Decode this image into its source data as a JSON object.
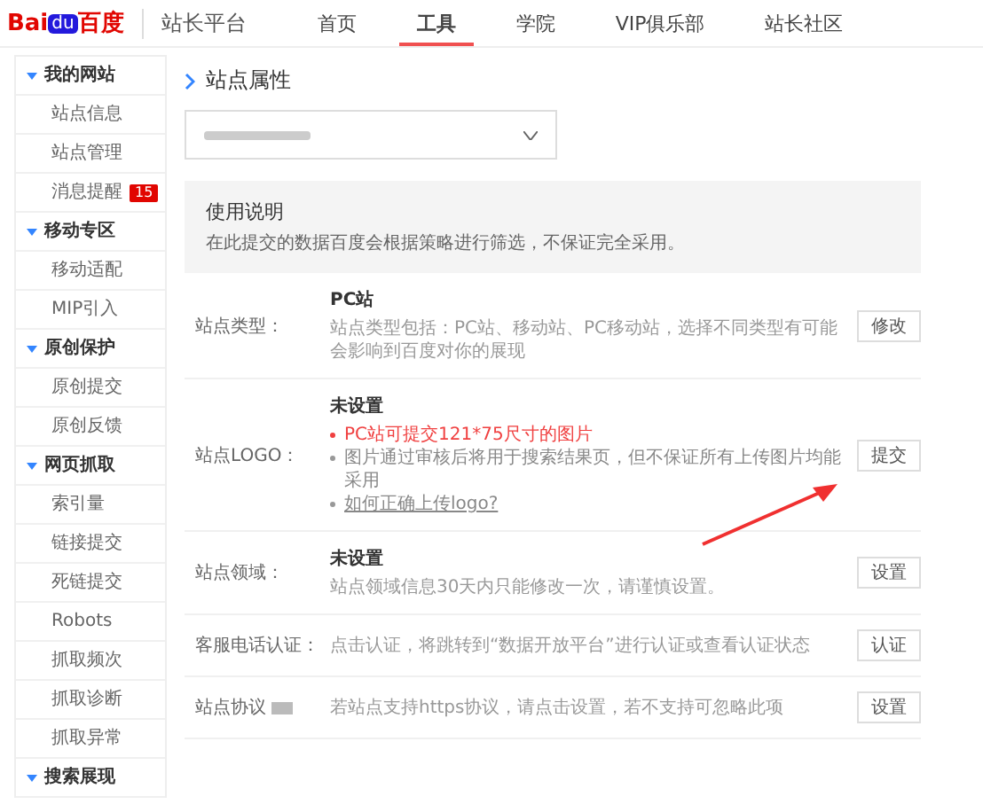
{
  "header": {
    "logo": {
      "part_1": "Bai",
      "part_2": "du",
      "part_3": "百度"
    },
    "product": "站长平台",
    "nav": [
      {
        "label": "首页",
        "selected": false
      },
      {
        "label": "工具",
        "selected": true
      },
      {
        "label": "学院",
        "selected": false
      },
      {
        "label": "VIP俱乐部",
        "selected": false
      },
      {
        "label": "站长社区",
        "selected": false
      }
    ]
  },
  "sidebar": [
    {
      "label": "我的网站",
      "expanded": true,
      "children": [
        {
          "label": "站点信息"
        },
        {
          "label": "站点管理"
        },
        {
          "label": "消息提醒",
          "badge": "15"
        }
      ]
    },
    {
      "label": "移动专区",
      "expanded": true,
      "children": [
        {
          "label": "移动适配"
        },
        {
          "label": "MIP引入"
        }
      ]
    },
    {
      "label": "原创保护",
      "expanded": true,
      "children": [
        {
          "label": "原创提交"
        },
        {
          "label": "原创反馈"
        }
      ]
    },
    {
      "label": "网页抓取",
      "expanded": true,
      "children": [
        {
          "label": "索引量"
        },
        {
          "label": "链接提交"
        },
        {
          "label": "死链提交"
        },
        {
          "label": "Robots"
        },
        {
          "label": "抓取频次"
        },
        {
          "label": "抓取诊断"
        },
        {
          "label": "抓取异常"
        }
      ]
    },
    {
      "label": "搜索展现",
      "expanded": true
    }
  ],
  "page_title": "站点属性",
  "notice": {
    "title": "使用说明",
    "text": "在此提交的数据百度会根据策略进行筛选，不保证完全采用。"
  },
  "rows": [
    {
      "label": "站点类型：",
      "value": "PC站",
      "lines": [
        {
          "kind": "plain",
          "text": "站点类型包括：PC站、移动站、PC移动站，选择不同类型有可能会影响到百度对你的展现"
        }
      ],
      "button": "修改"
    },
    {
      "label": "站点LOGO：",
      "value": "未设置",
      "lines": [
        {
          "kind": "warning",
          "text": "PC站可提交121*75尺寸的图片"
        },
        {
          "kind": "bullet",
          "text": "图片通过审核后将用于搜索结果页，但不保证所有上传图片均能采用"
        },
        {
          "kind": "link",
          "text": "如何正确上传logo?"
        }
      ],
      "button": "提交"
    },
    {
      "label": "站点领域：",
      "value": "未设置",
      "lines": [
        {
          "kind": "plain",
          "text": "站点领域信息30天内只能修改一次，请谨慎设置。"
        }
      ],
      "button": "设置"
    },
    {
      "label": "客服电话认证：",
      "lines": [
        {
          "kind": "plain",
          "text": "点击认证，将跳转到“数据开放平台”进行认证或查看认证状态"
        }
      ],
      "button": "认证"
    },
    {
      "label": "站点协议",
      "lines": [
        {
          "kind": "plain",
          "text": "若站点支持https协议，请点击设置，若不支持可忽略此项"
        }
      ],
      "button": "设置",
      "tag": true
    }
  ]
}
